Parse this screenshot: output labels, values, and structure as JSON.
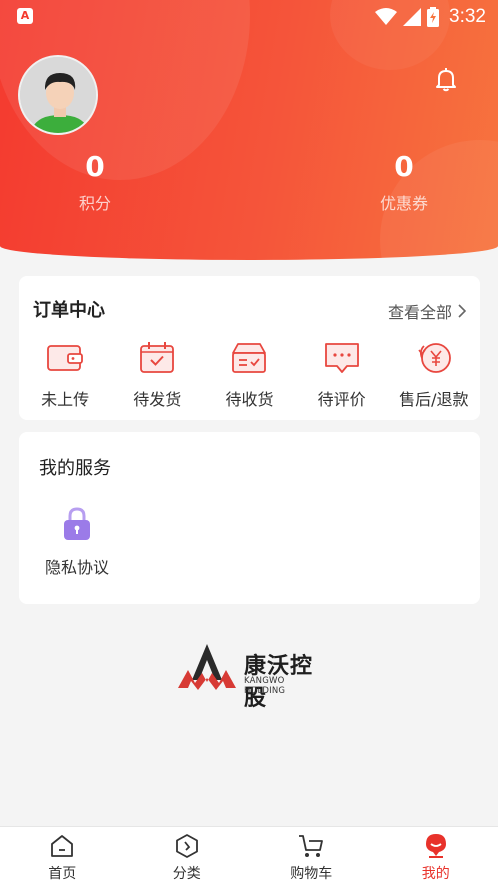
{
  "status_bar": {
    "time": "3:32",
    "app_badge": "A"
  },
  "profile": {
    "stats": [
      {
        "value": "0",
        "label": "积分"
      },
      {
        "value": "0",
        "label": "优惠券"
      }
    ]
  },
  "orders": {
    "title": "订单中心",
    "view_all": "查看全部",
    "items": [
      {
        "label": "未上传",
        "icon": "wallet-icon"
      },
      {
        "label": "待发货",
        "icon": "calendar-check-icon"
      },
      {
        "label": "待收货",
        "icon": "box-icon"
      },
      {
        "label": "待评价",
        "icon": "chat-icon"
      },
      {
        "label": "售后/退款",
        "icon": "refund-yen-icon"
      }
    ]
  },
  "services": {
    "title": "我的服务",
    "items": [
      {
        "label": "隐私协议",
        "icon": "lock-icon"
      }
    ]
  },
  "logo": {
    "name_cn": "康沃控股",
    "name_en": "KANGWO HOLDING"
  },
  "tabbar": {
    "items": [
      {
        "label": "首页",
        "icon": "home-icon"
      },
      {
        "label": "分类",
        "icon": "category-icon"
      },
      {
        "label": "购物车",
        "icon": "cart-icon"
      },
      {
        "label": "我的",
        "icon": "mine-icon",
        "active": true
      }
    ]
  },
  "colors": {
    "accent": "#e8322b",
    "hero_start": "#f43a2f",
    "hero_end": "#f7743e",
    "lock": "#9b7be8"
  }
}
